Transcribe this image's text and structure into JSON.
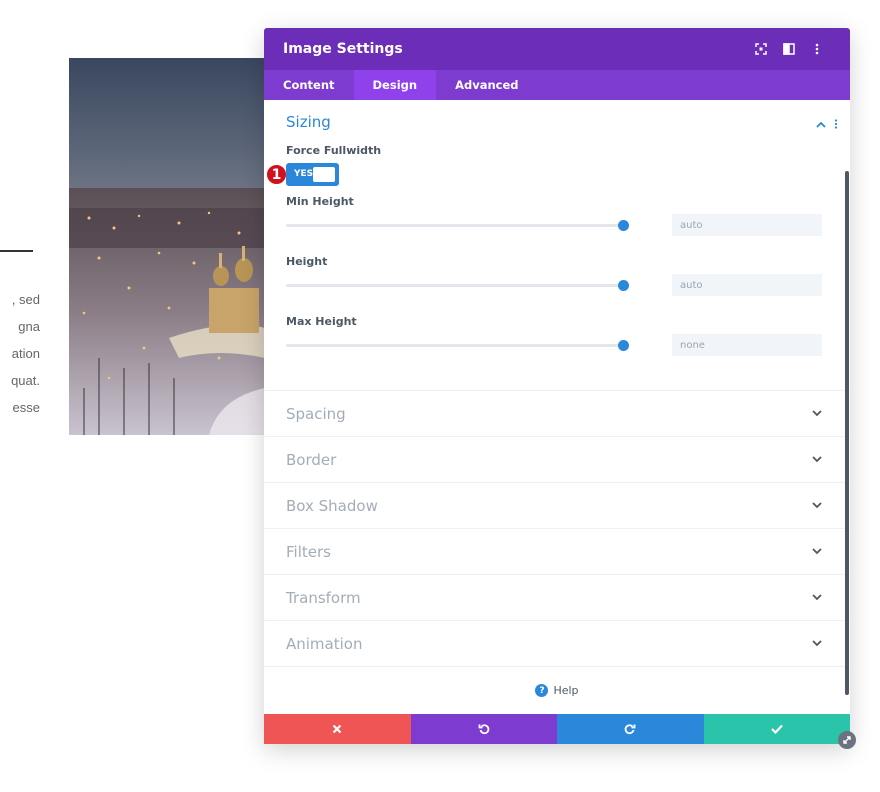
{
  "background": {
    "text_fragments": [
      ", sed",
      "gna",
      "ation",
      "quat.",
      "esse"
    ]
  },
  "modal": {
    "title": "Image Settings",
    "tabs": [
      {
        "label": "Content"
      },
      {
        "label": "Design"
      },
      {
        "label": "Advanced"
      }
    ],
    "active_tab": "Design",
    "sizing": {
      "title": "Sizing",
      "force_fullwidth": {
        "label": "Force Fullwidth",
        "toggle_text": "YES",
        "step_badge": "1"
      },
      "min_height": {
        "label": "Min Height",
        "value": "auto"
      },
      "height": {
        "label": "Height",
        "value": "auto"
      },
      "max_height": {
        "label": "Max Height",
        "value": "none"
      }
    },
    "sections": [
      {
        "label": "Spacing"
      },
      {
        "label": "Border"
      },
      {
        "label": "Box Shadow"
      },
      {
        "label": "Filters"
      },
      {
        "label": "Transform"
      },
      {
        "label": "Animation"
      }
    ],
    "help_label": "Help"
  },
  "colors": {
    "header": "#6c2eb9",
    "tabs": "#7e3bd0",
    "accent": "#2b87da",
    "cancel": "#ef5555",
    "undo": "#7e3bd0",
    "redo": "#2b87da",
    "save": "#29c4a9"
  }
}
